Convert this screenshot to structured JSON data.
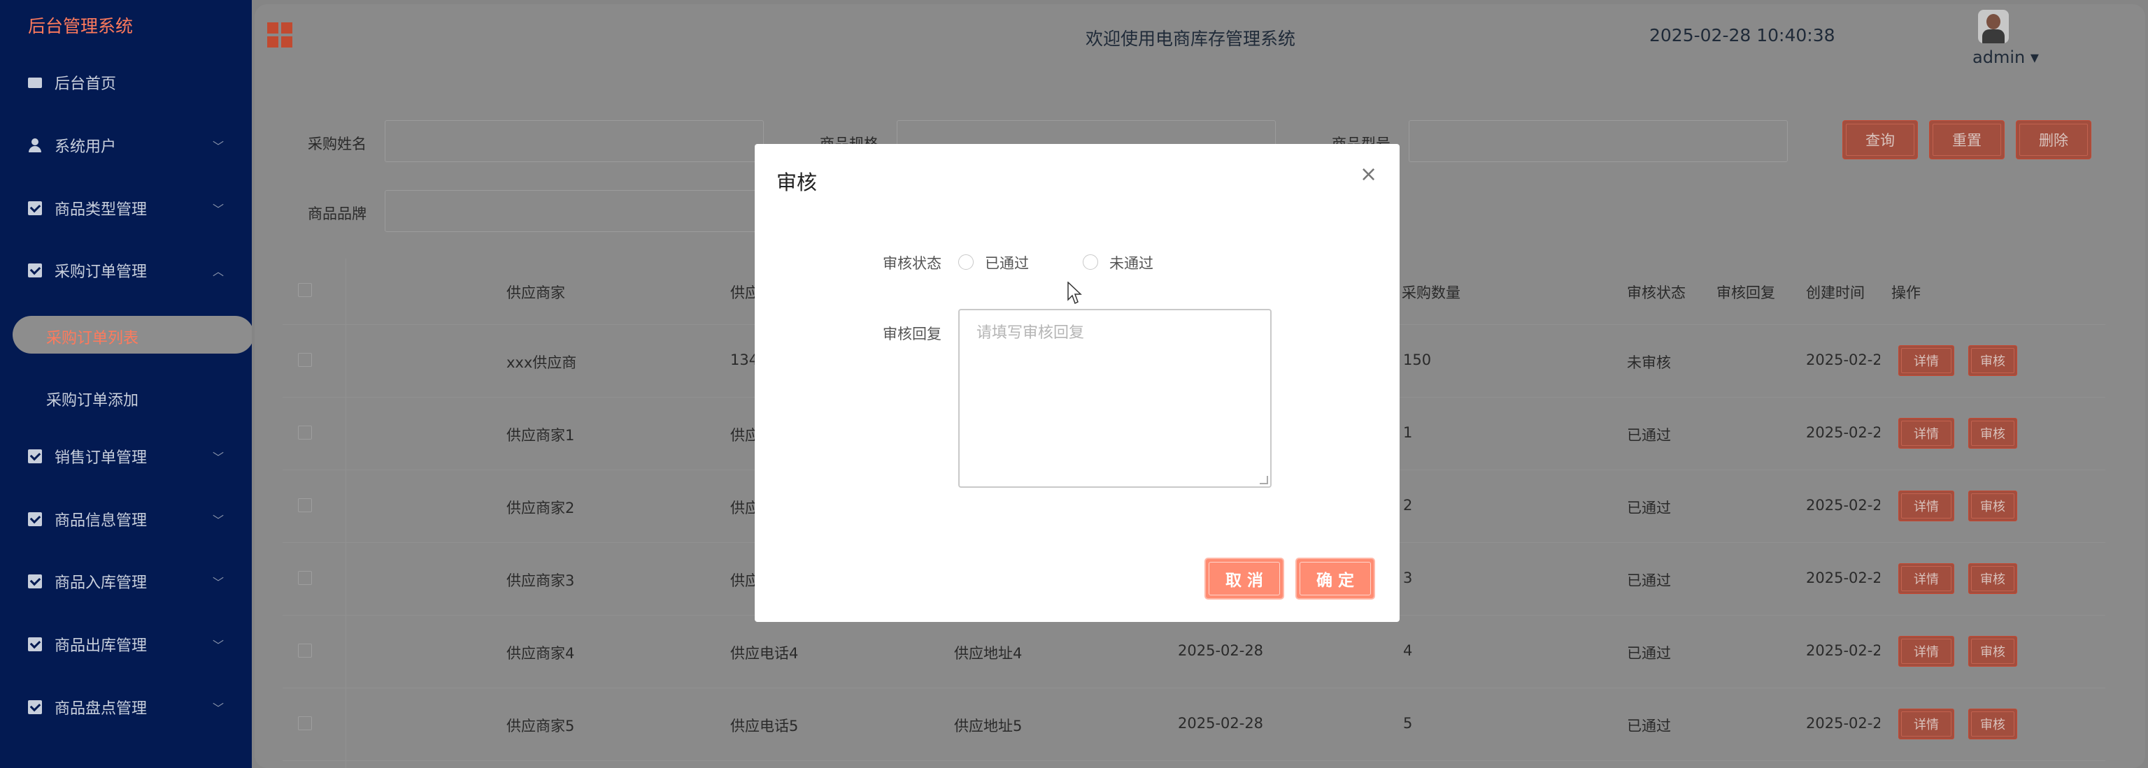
{
  "sidebar": {
    "brand": "后台管理系统",
    "items": [
      {
        "label": "后台首页"
      },
      {
        "label": "系统用户"
      },
      {
        "label": "商品类型管理"
      },
      {
        "label": "采购订单管理"
      },
      {
        "label": "销售订单管理"
      },
      {
        "label": "商品信息管理"
      },
      {
        "label": "商品入库管理"
      },
      {
        "label": "商品出库管理"
      },
      {
        "label": "商品盘点管理"
      }
    ],
    "sub_items": [
      {
        "label": "采购订单列表"
      },
      {
        "label": "采购订单添加"
      }
    ]
  },
  "header": {
    "title": "欢迎使用电商库存管理系统",
    "time": "2025-02-28 10:40:38",
    "user": "admin ▾"
  },
  "filters": {
    "label_1": "采购姓名",
    "label_2": "商品规格",
    "label_3": "商品型号",
    "label_4": "商品品牌",
    "query": "查询",
    "reset": "重置",
    "delete": "删除"
  },
  "table": {
    "headers": [
      "供应商家",
      "供应",
      "采购数量",
      "审核状态",
      "审核回复",
      "创建时间",
      "操作"
    ],
    "rows": [
      {
        "vendor": "xxx供应商",
        "phone": "134",
        "address": "",
        "date": "",
        "qty": "150",
        "status": "未审核",
        "created": "2025-02-2"
      },
      {
        "vendor": "供应商家1",
        "phone": "供应",
        "address": "",
        "date": "",
        "qty": "1",
        "status": "已通过",
        "created": "2025-02-2"
      },
      {
        "vendor": "供应商家2",
        "phone": "供应",
        "address": "",
        "date": "",
        "qty": "2",
        "status": "已通过",
        "created": "2025-02-2"
      },
      {
        "vendor": "供应商家3",
        "phone": "供应",
        "address": "",
        "date": "",
        "qty": "3",
        "status": "已通过",
        "created": "2025-02-2"
      },
      {
        "vendor": "供应商家4",
        "phone": "供应电话4",
        "address": "供应地址4",
        "date": "2025-02-28",
        "qty": "4",
        "status": "已通过",
        "created": "2025-02-2"
      },
      {
        "vendor": "供应商家5",
        "phone": "供应电话5",
        "address": "供应地址5",
        "date": "2025-02-28",
        "qty": "5",
        "status": "已通过",
        "created": "2025-02-2"
      }
    ],
    "detail_btn": "详情",
    "audit_btn": "审核"
  },
  "modal": {
    "title": "审核",
    "close": "×",
    "status_label": "审核状态",
    "option_pass": "已通过",
    "option_fail": "未通过",
    "reply_label": "审核回复",
    "reply_placeholder": "请填写审核回复",
    "cancel": "取 消",
    "confirm": "确 定"
  },
  "colors": {
    "sidebar_bg": "#031a52",
    "accent": "#ff7a5c",
    "button": "#ff8c72"
  }
}
